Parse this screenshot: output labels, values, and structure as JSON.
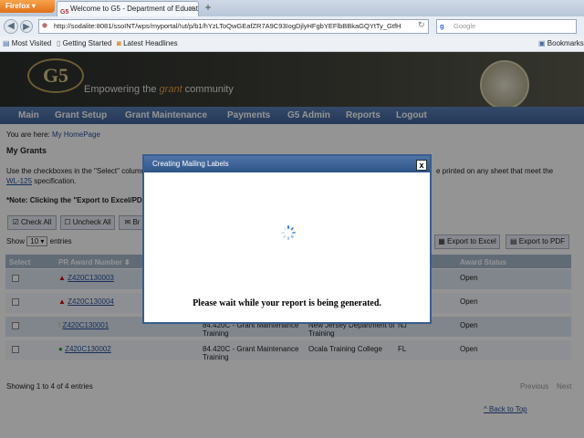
{
  "browser": {
    "menu_label": "Firefox",
    "tab_title": "Welcome to G5 - Department of Educati...",
    "tab_favicon": "G5",
    "new_tab": "+",
    "url": "http://sodalite:8081/ssoINT/wps/myportal/!ut/p/b1/hYzLToQwGEafZR7A9C93IogDjlyHFgbYEFlbBBkaGQYtTy_GtfH",
    "search_placeholder": "Google",
    "bookmarks": [
      "Most Visited",
      "Getting Started",
      "Latest Headlines"
    ],
    "bookmarks_menu": "Bookmarks"
  },
  "header": {
    "logo": "G5",
    "tagline_pre": "Empowering the ",
    "tagline_accent": "grant",
    "tagline_post": " community"
  },
  "menu": [
    "Main",
    "Grant Setup",
    "Grant Maintenance",
    "Payments",
    "G5 Admin",
    "Reports",
    "Logout"
  ],
  "breadcrumb": {
    "prefix": "You are here:",
    "link": "My HomePage"
  },
  "page": {
    "title": "My Grants",
    "instructions_a": "Use the checkboxes in the \"Select\" column t",
    "instructions_b": "e printed on any sheet that meet the",
    "spec_link": "WL-125",
    "spec_suffix": " specification.",
    "note": "*Note: Clicking the \"Export to Excel/PDF\" b",
    "check_all": "Check All",
    "uncheck_all": "Uncheck All",
    "br": "Br",
    "show": "Show",
    "show_count": "10",
    "entries": "entries",
    "export_excel": "Export to Excel",
    "export_pdf": "Export to PDF",
    "col_select": "Select",
    "col_award_number": "PR Award Number",
    "col_award_status": "Award Status",
    "rows": [
      {
        "award": "Z420C130003",
        "program": "",
        "program2": "",
        "recipient": "",
        "recipient2": "",
        "state": "",
        "status": "Open",
        "flag": "warn"
      },
      {
        "award": "Z420C130004",
        "program": "",
        "program2": "",
        "recipient": "",
        "recipient2": "",
        "state": "",
        "status": "Open",
        "flag": "warn"
      },
      {
        "award": "Z420C130001",
        "program": "84.420C - Grant Maintenance",
        "program2": "Training",
        "recipient": "New Jersey Department of",
        "recipient2": "Training",
        "state": "NJ",
        "status": "Open",
        "flag": "alert"
      },
      {
        "award": "Z420C130002",
        "program": "84.420C - Grant Maintenance",
        "program2": "Training",
        "recipient": "Ocala Training College",
        "recipient2": "",
        "state": "FL",
        "status": "Open",
        "flag": "ok"
      }
    ],
    "showing": "Showing 1 to 4 of 4 entries",
    "previous": "Previous",
    "next": "Next",
    "back_to_top": "^ Back to Top"
  },
  "modal": {
    "title": "Creating Mailing Labels",
    "close": "x",
    "message": "Please wait while your report is being generated."
  }
}
